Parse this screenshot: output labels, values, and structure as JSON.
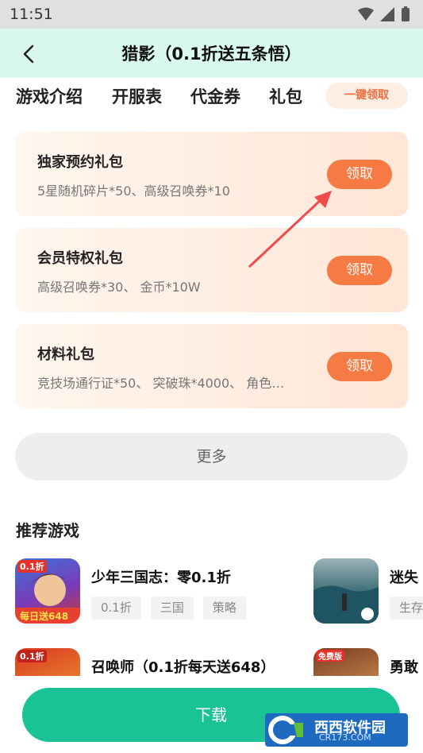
{
  "status_bar": {
    "time": "11:51"
  },
  "header": {
    "title": "猎影（0.1折送五条悟）"
  },
  "tabs": [
    {
      "label": "游戏介绍"
    },
    {
      "label": "开服表"
    },
    {
      "label": "代金券"
    },
    {
      "label": "礼包",
      "active": true
    }
  ],
  "claim_all_label": "一键领取",
  "gifts": [
    {
      "name": "独家预约礼包",
      "desc": "5星随机碎片*50、高级召唤券*10",
      "button": "领取"
    },
    {
      "name": "会员特权礼包",
      "desc": "高级召唤券*30、 金币*10W",
      "button": "领取"
    },
    {
      "name": "材料礼包",
      "desc": "竞技场通行证*50、 突破珠*4000、 角色…",
      "button": "领取"
    }
  ],
  "more_label": "更多",
  "recommend": {
    "title": "推荐游戏",
    "games": [
      {
        "name": "少年三国志：零0.1折",
        "tags": [
          "0.1折",
          "三国",
          "策略"
        ],
        "icon_label": "0.1折",
        "icon_banner": "每日送648"
      },
      {
        "name": "迷失",
        "tags": [
          "生存"
        ]
      },
      {
        "name": "召唤师（0.1折每天送648）",
        "tags": [],
        "icon_label": "0.1折"
      },
      {
        "name": "勇敢",
        "tags": [],
        "icon_label": "免费版"
      }
    ]
  },
  "download_label": "下载",
  "watermark": {
    "text": "西西软件园",
    "sub": "CR173.COM"
  },
  "colors": {
    "accent": "#19c396",
    "orange": "#f57a44",
    "header_bg": "#d8f8f0",
    "arrow": "#ee4b4b"
  }
}
